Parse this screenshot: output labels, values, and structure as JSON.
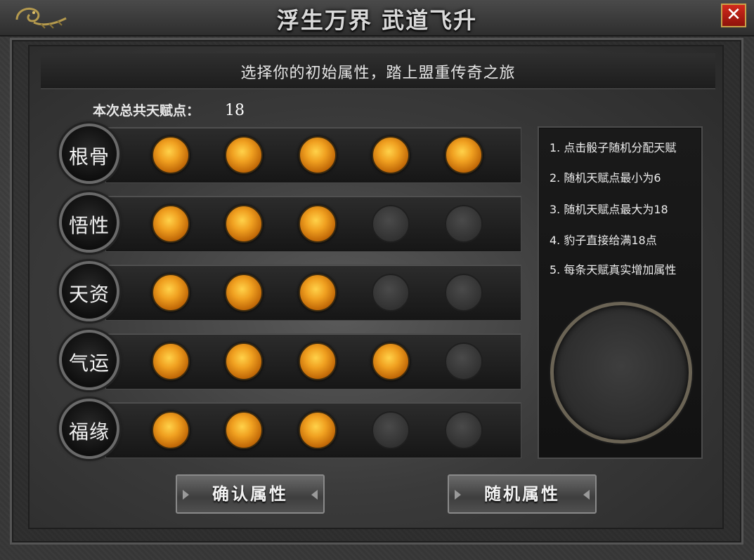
{
  "window": {
    "title": "浮生万界  武道飞升",
    "close_label": "✕"
  },
  "header": {
    "subtitle": "选择你的初始属性，踏上盟重传奇之旅"
  },
  "points": {
    "label": "本次总共天赋点：",
    "value": "18"
  },
  "attributes": [
    {
      "label": "根骨",
      "filled": 5,
      "max": 5
    },
    {
      "label": "悟性",
      "filled": 3,
      "max": 5
    },
    {
      "label": "天资",
      "filled": 3,
      "max": 5
    },
    {
      "label": "气运",
      "filled": 4,
      "max": 5
    },
    {
      "label": "福缘",
      "filled": 3,
      "max": 5
    }
  ],
  "rules": [
    "1. 点击骰子随机分配天赋",
    "2. 随机天赋点最小为6",
    "3. 随机天赋点最大为18",
    "4. 豹子直接给满18点",
    "5. 每条天赋真实增加属性"
  ],
  "buttons": {
    "confirm": "确认属性",
    "random": "随机属性"
  },
  "colors": {
    "orb_active": "#f0a020",
    "orb_inactive": "#353535",
    "close_button": "#c0201a"
  }
}
